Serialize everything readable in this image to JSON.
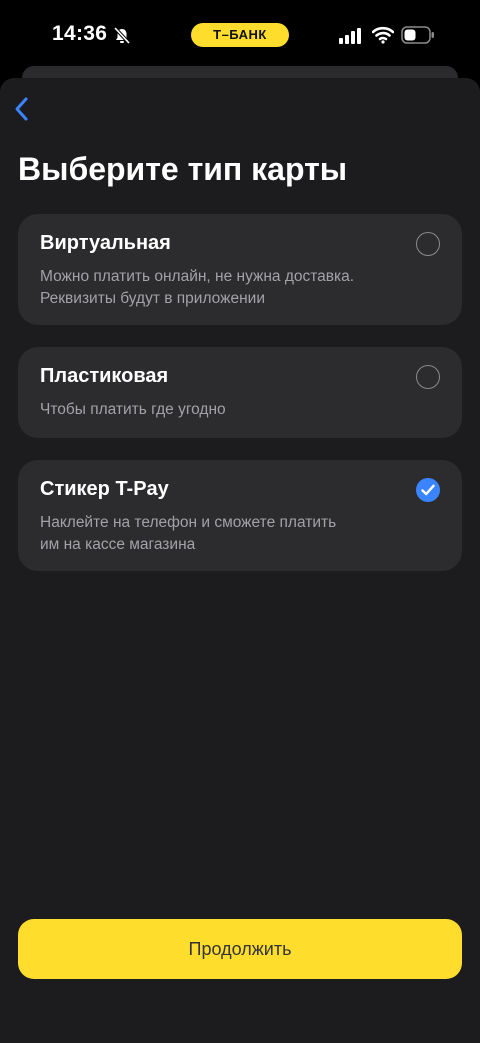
{
  "status_bar": {
    "time": "14:36",
    "carrier_pill": "Т–БАНК"
  },
  "header": {
    "title": "Выберите тип карты"
  },
  "options": [
    {
      "title": "Виртуальная",
      "description": [
        "Можно платить онлайн, не нужна доставка.",
        "Реквизиты будут в приложении"
      ],
      "selected": false
    },
    {
      "title": "Пластиковая",
      "description": [
        "Чтобы платить где угодно"
      ],
      "selected": false
    },
    {
      "title": "Стикер T-Pay",
      "description": [
        "Наклейте на телефон и сможете платить",
        "им на кассе магазина"
      ],
      "selected": true
    }
  ],
  "footer": {
    "continue_label": "Продолжить"
  },
  "colors": {
    "accent_yellow": "#ffdd2d",
    "check_blue": "#3a84ff",
    "back_blue": "#3a84ff",
    "card_bg": "#2c2c2e",
    "sheet_bg": "#1c1c1e"
  }
}
